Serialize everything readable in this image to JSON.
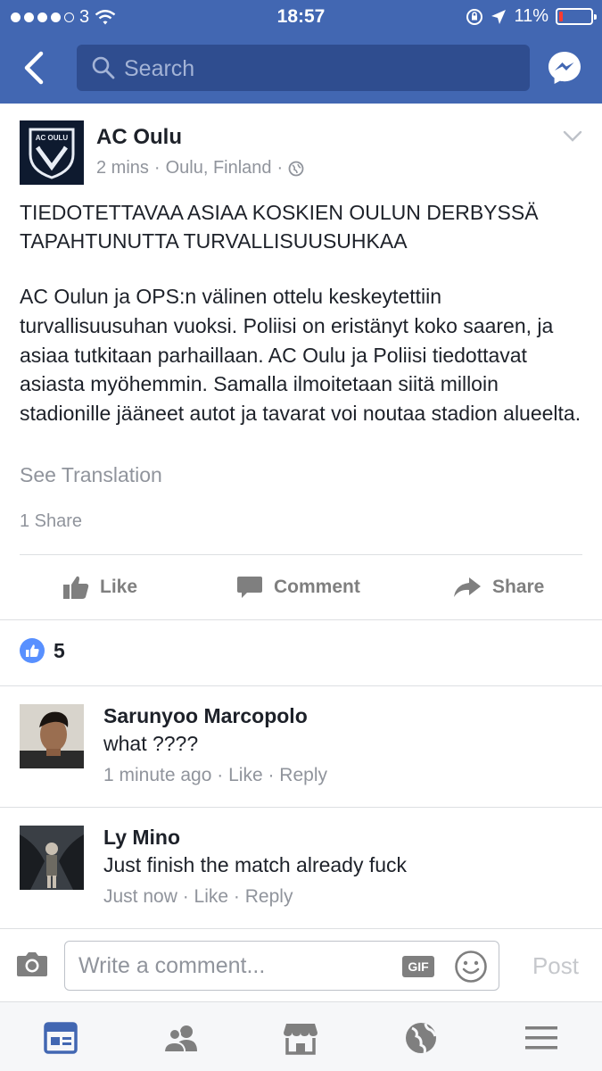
{
  "status": {
    "carrier": "3",
    "time": "18:57",
    "battery": "11%",
    "battery_level": 0.11,
    "signal_bars": 4
  },
  "nav": {
    "search_placeholder": "Search"
  },
  "post": {
    "page_name": "AC Oulu",
    "time_ago": "2 mins",
    "location": "Oulu, Finland",
    "separator": "·",
    "logo_text": "AC OULU",
    "title": "TIEDOTETTAVAA ASIAA KOSKIEN OULUN DERBYSSÄ\nTAPAHTUNUTTA TURVALLISUUSUHKAA",
    "body": "AC Oulun ja OPS:n välinen ottelu keskeytettiin turvallisuusuhan vuoksi. Poliisi on eristänyt koko saaren, ja asiaa tutkitaan parhaillaan. AC Oulu ja Poliisi tiedottavat asiasta myöhemmin. Samalla ilmoitetaan siitä milloin stadionille jääneet autot ja tavarat voi noutaa stadion alueelta.",
    "see_translation": "See Translation",
    "shares": "1 Share"
  },
  "actions": {
    "like": "Like",
    "comment": "Comment",
    "share": "Share"
  },
  "reactions": {
    "count": "5"
  },
  "comments": [
    {
      "name": "Sarunyoo Marcopolo",
      "text": "what ????",
      "time": "1 minute ago",
      "like": "Like",
      "reply": "Reply",
      "sep": " · "
    },
    {
      "name": "Ly Mino",
      "text": "Just finish the match already fuck",
      "time": "Just now",
      "like": "Like",
      "reply": "Reply",
      "sep": " · "
    }
  ],
  "composer": {
    "placeholder": "Write a comment...",
    "gif_label": "GIF",
    "post_label": "Post"
  },
  "colors": {
    "brand": "#4267b2",
    "like_blue": "#5890ff",
    "battery_low": "#ff3b30"
  }
}
